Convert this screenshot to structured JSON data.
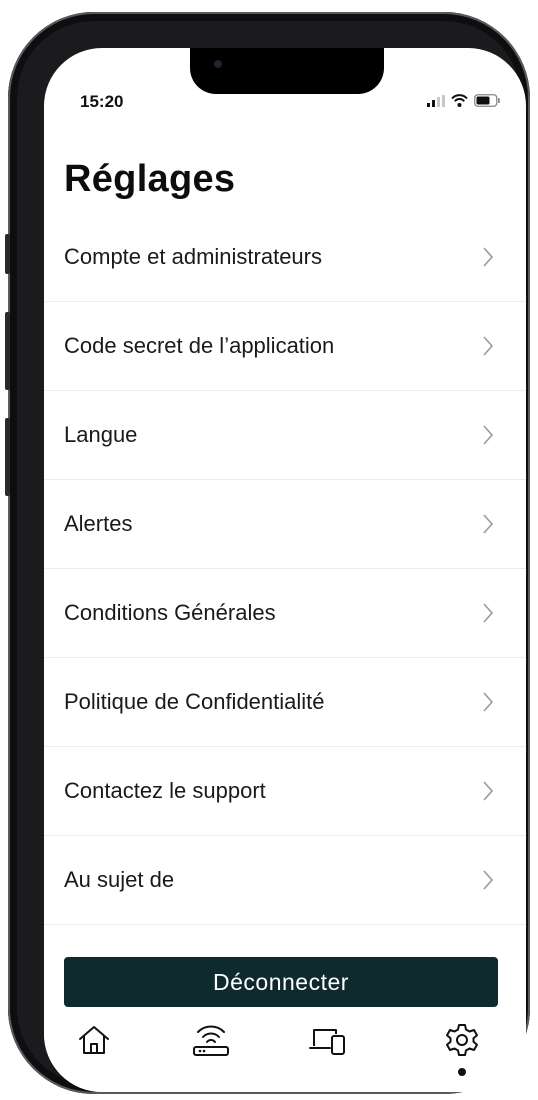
{
  "status_bar": {
    "time": "15:20"
  },
  "page": {
    "title": "Réglages"
  },
  "settings": [
    {
      "label": "Compte et administrateurs"
    },
    {
      "label": "Code secret de l’application"
    },
    {
      "label": "Langue"
    },
    {
      "label": "Alertes"
    },
    {
      "label": "Conditions Générales"
    },
    {
      "label": "Politique de Confidentialité"
    },
    {
      "label": "Contactez le support"
    },
    {
      "label": "Au sujet de"
    }
  ],
  "logout": {
    "label": "Déconnecter"
  },
  "tabbar": {
    "tabs": [
      {
        "icon": "home-icon"
      },
      {
        "icon": "router-icon"
      },
      {
        "icon": "devices-icon"
      },
      {
        "icon": "settings-icon",
        "active": true
      }
    ]
  },
  "colors": {
    "button_bg": "#0f2a2f",
    "text": "#1a1a1a",
    "divider": "#ececec"
  }
}
